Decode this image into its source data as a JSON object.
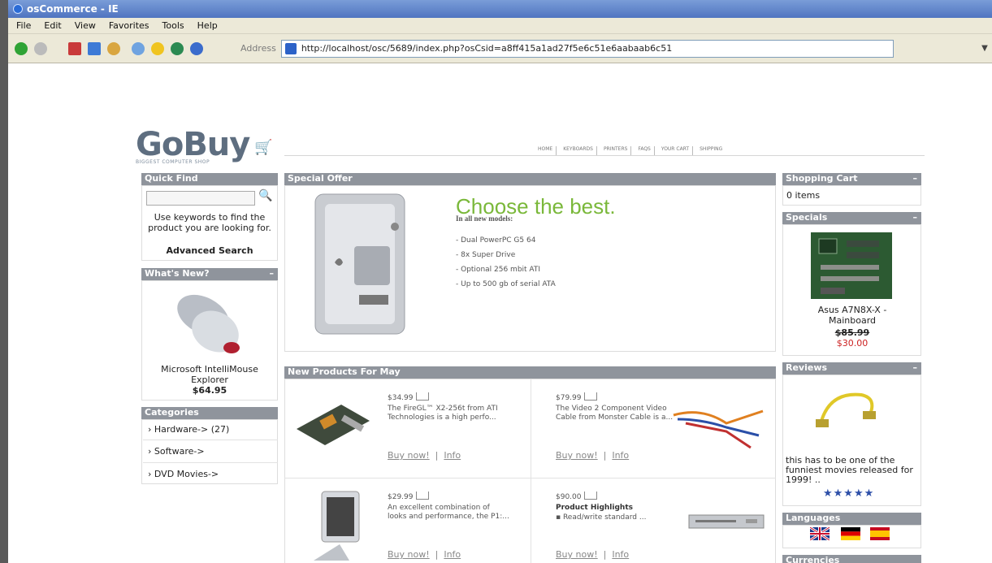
{
  "window": {
    "title": "osCommerce - IE"
  },
  "menu": [
    "File",
    "Edit",
    "View",
    "Favorites",
    "Tools",
    "Help"
  ],
  "address": {
    "label": "Address",
    "url": "http://localhost/osc/5689/index.php?osCsid=a8ff415a1ad27f5e6c51e6aabaab6c51"
  },
  "site": {
    "logo": "GoBuy",
    "tagline": "BIGGEST COMPUTER SHOP",
    "nav": [
      "HOME",
      "KEYBOARDS",
      "PRINTERS",
      "FAQS",
      "YOUR CART",
      "SHIPPING"
    ]
  },
  "quick_find": {
    "title": "Quick Find",
    "help": "Use keywords to find the product you are looking for.",
    "advanced": "Advanced Search"
  },
  "whats_new": {
    "title": "What's New?",
    "product": "Microsoft IntelliMouse Explorer",
    "price": "$64.95"
  },
  "categories": {
    "title": "Categories",
    "items": [
      "Hardware-> (27)",
      "Software->",
      "DVD Movies->"
    ]
  },
  "special_offer": {
    "title": "Special Offer",
    "headline": "Choose the best.",
    "subhead": "In all new models:",
    "bullets": [
      "- Dual PowerPC G5 64",
      "- 8x Super Drive",
      "- Optional 256 mbit ATI",
      "- Up to 500 gb of serial ATA"
    ]
  },
  "new_products": {
    "title": "New Products For May",
    "items": [
      {
        "price": "$34.99",
        "desc": "The FireGL™ X2-256t from ATI Technologies is a high perfo...",
        "buy": "Buy now!",
        "info": "Info"
      },
      {
        "price": "$79.99",
        "desc": "The Video 2 Component Video Cable from Monster Cable is a...",
        "buy": "Buy now!",
        "info": "Info"
      },
      {
        "price": "$29.99",
        "desc": "An excellent combination of looks and performance, the P1:...",
        "buy": "Buy now!",
        "info": "Info"
      },
      {
        "price": "$90.00",
        "title": "Product Highlights",
        "desc": "▪ Read/write standard ...",
        "buy": "Buy now!",
        "info": "Info"
      }
    ]
  },
  "shopping_cart": {
    "title": "Shopping Cart",
    "text": "0 items"
  },
  "specials": {
    "title": "Specials",
    "product": "Asus A7N8X-X - Mainboard",
    "old_price": "$85.99",
    "new_price": "$30.00"
  },
  "reviews": {
    "title": "Reviews",
    "text": "this has to be one of the funniest movies released for 1999! ..",
    "stars": "★★★★★"
  },
  "languages": {
    "title": "Languages"
  },
  "currencies": {
    "title": "Currencies"
  },
  "colors": {
    "box_header": "#8f949c",
    "offer_green": "#7ab83a",
    "special_price": "#cc2222"
  }
}
